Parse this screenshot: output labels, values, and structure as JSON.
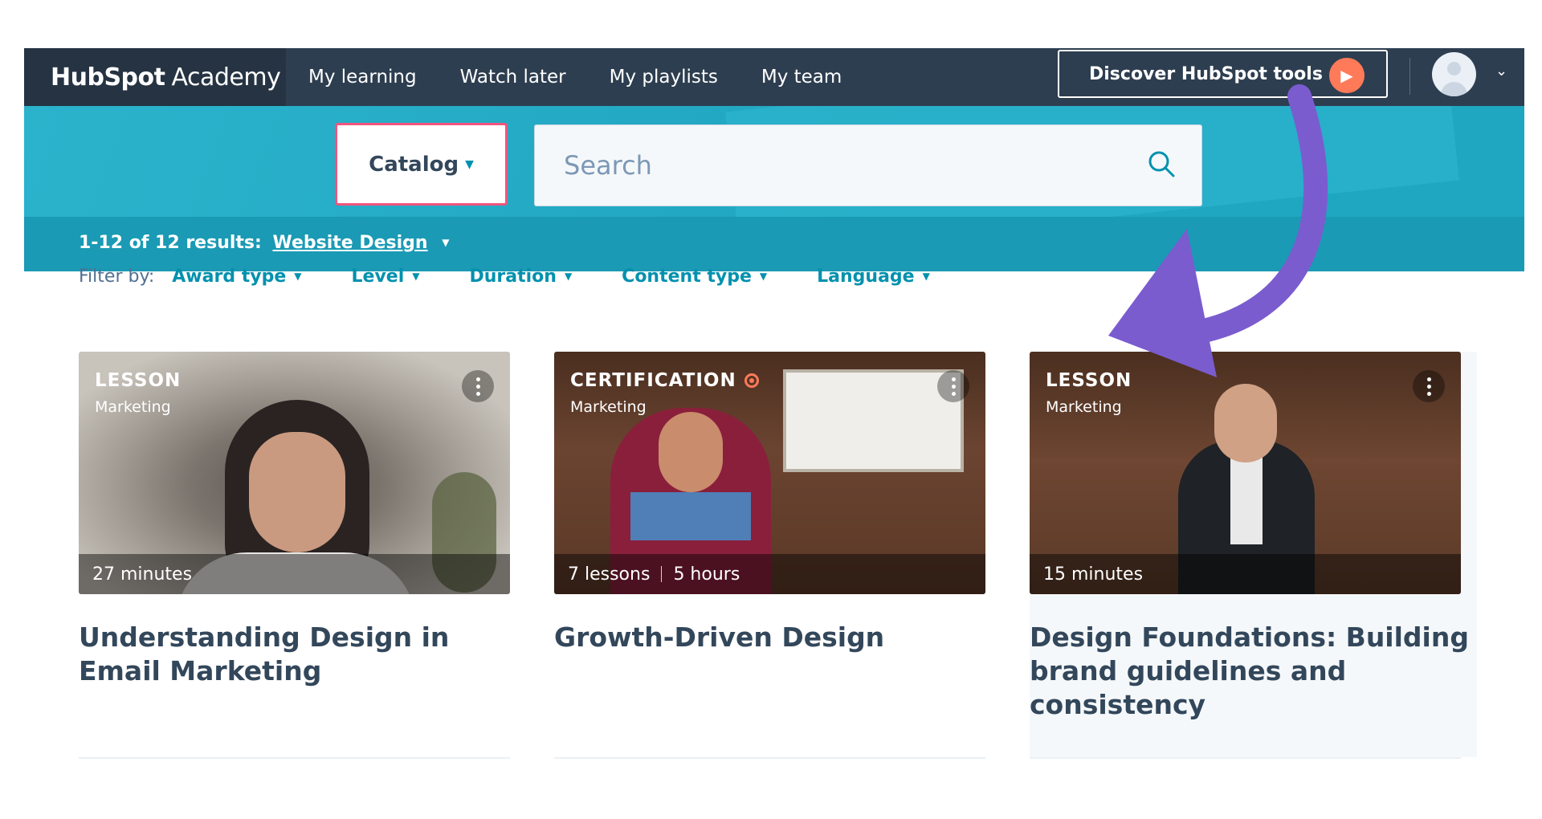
{
  "nav": {
    "logo_bold": "HubSpot",
    "logo_light": "Academy",
    "links": [
      "My learning",
      "Watch later",
      "My playlists",
      "My team"
    ],
    "discover_label": "Discover HubSpot tools"
  },
  "search": {
    "catalog_label": "Catalog",
    "placeholder": "Search"
  },
  "results": {
    "prefix": "1-12 of 12 results:",
    "topic": "Website Design"
  },
  "filters": {
    "label": "Filter by:",
    "items": [
      "Award type",
      "Level",
      "Duration",
      "Content type",
      "Language"
    ]
  },
  "cards": [
    {
      "type": "LESSON",
      "category": "Marketing",
      "meta1": "27 minutes",
      "meta2": "",
      "title": "Understanding Design in Email Marketing"
    },
    {
      "type": "CERTIFICATION",
      "category": "Marketing",
      "meta1": "7 lessons",
      "meta2": "5 hours",
      "title": "Growth-Driven Design"
    },
    {
      "type": "LESSON",
      "category": "Marketing",
      "meta1": "15 minutes",
      "meta2": "",
      "title": "Design Foundations: Building brand guidelines and consistency"
    }
  ],
  "colors": {
    "nav_bg": "#2d3e50",
    "band_bg": "#1fa6c0",
    "accent_link": "#0091ae",
    "catalog_border": "#f2547d",
    "play_orange": "#ff7a59",
    "annotation_arrow": "#7a5ccf"
  }
}
